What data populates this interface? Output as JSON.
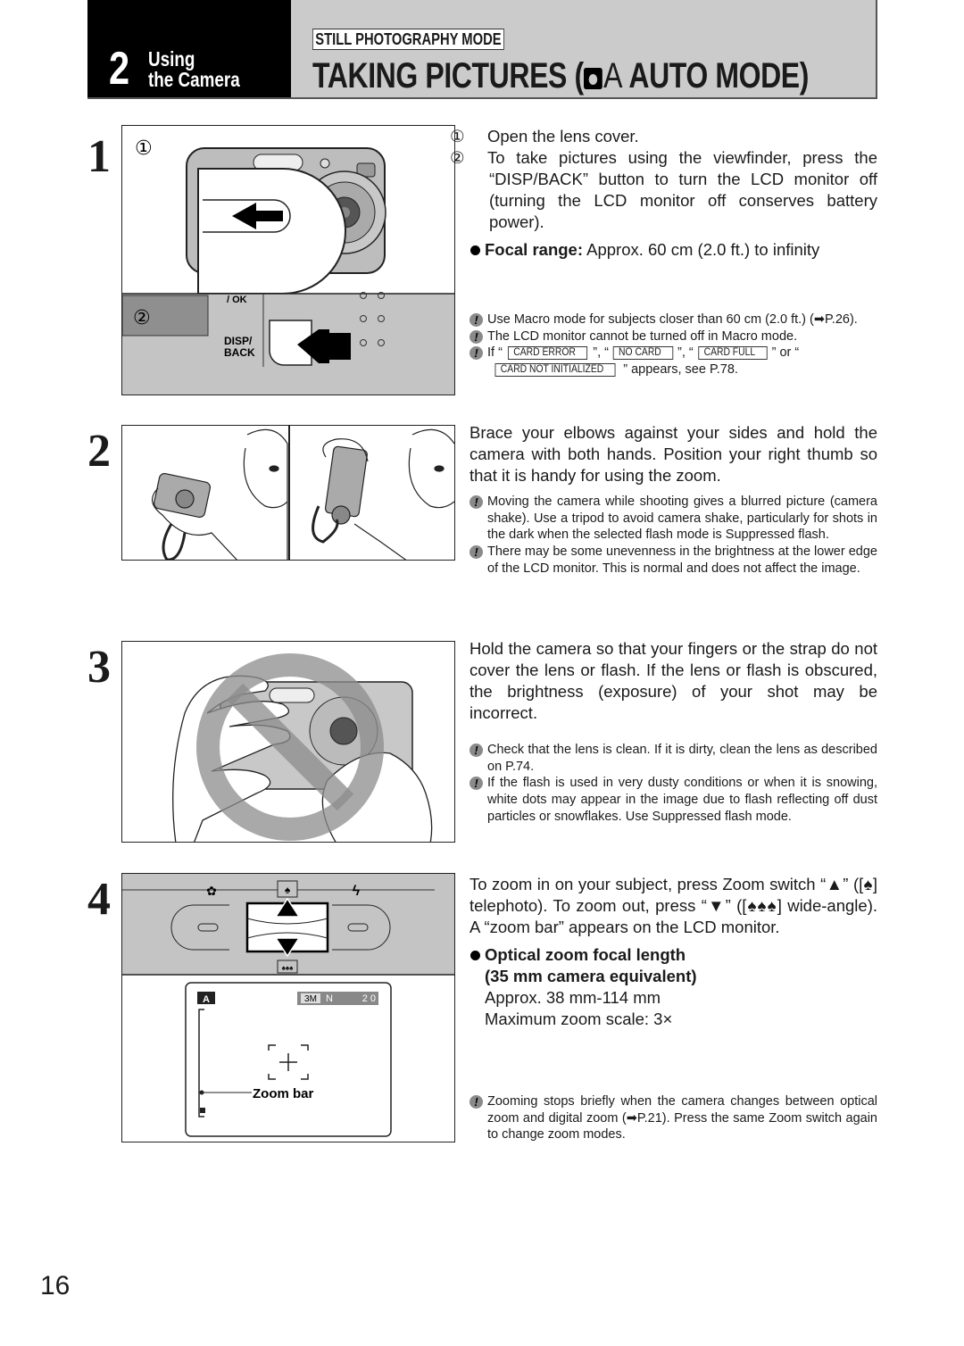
{
  "header": {
    "chapter_number": "2",
    "chapter_title_line1": "Using",
    "chapter_title_line2": "the Camera",
    "mode_label": "STILL PHOTOGRAPHY MODE",
    "title_prefix": "TAKING PICTURES (",
    "title_mode_letter": "A",
    "title_suffix": " AUTO MODE)",
    "colors": {
      "band": "#cbcbcb",
      "chapter_block": "#000000"
    }
  },
  "steps": [
    {
      "number": "1",
      "figure": {
        "sub1": "①",
        "sub2": "②",
        "label_ok": "/ OK",
        "label_disp1": "DISP/",
        "label_disp2": "BACK"
      },
      "items": [
        {
          "marker": "①",
          "text": "Open the lens cover."
        },
        {
          "marker": "②",
          "text": "To take pictures using the viewfinder, press the “DISP/BACK” button to turn the LCD monitor off (turning the LCD monitor off conserves battery power)."
        }
      ],
      "bullet": {
        "label": "Focal range:",
        "text": " Approx. 60 cm (2.0 ft.) to infinity"
      },
      "notes": [
        {
          "text": "Use Macro mode for subjects closer than 60 cm (2.0 ft.) (➡P.26)."
        },
        {
          "text": "The LCD monitor cannot be turned off in Macro mode."
        }
      ],
      "card_note": {
        "prefix": "If “",
        "tag1": "CARD ERROR",
        "sep1": "”, “",
        "tag2": "NO CARD",
        "sep2": "”, “",
        "tag3": "CARD FULL",
        "sep3": "” or “",
        "tag4": "CARD NOT INITIALIZED",
        "suffix": "” appears, see P.78."
      }
    },
    {
      "number": "2",
      "body": "Brace your elbows against your sides and hold the camera with both hands. Position your right thumb so that it is handy for using the zoom.",
      "notes": [
        {
          "text": "Moving the camera while shooting gives a blurred picture (camera shake). Use a tripod to avoid camera shake, particularly for shots in the dark when the selected flash mode is Suppressed flash."
        },
        {
          "text": "There may be some unevenness in the brightness at the lower edge of the LCD monitor. This is normal and does not affect the image."
        }
      ]
    },
    {
      "number": "3",
      "body": "Hold the camera so that your fingers or the strap do not cover the lens or flash. If the lens or flash is obscured, the brightness (exposure) of your shot may be incorrect.",
      "notes": [
        {
          "text": "Check that the lens is clean. If it is dirty, clean the lens as described on P.74."
        },
        {
          "text": "If the flash is used in very dusty conditions or when it is snowing, white dots may appear in the image due to flash reflecting off dust particles or snowflakes. Use Suppressed flash mode."
        }
      ]
    },
    {
      "number": "4",
      "figure": {
        "lcd_mode": "A",
        "lcd_quality_size": "3M",
        "lcd_quality": "N",
        "lcd_shots_remaining": "2 0",
        "zoom_bar_label": "Zoom bar"
      },
      "body": "To zoom in on your subject, press Zoom switch “▲” ([♠] telephoto).  To zoom out, press “▼” ([♠♠♠] wide-angle). A “zoom bar” appears on the LCD monitor.",
      "bullet": {
        "label_line1": "Optical zoom focal length",
        "label_line2": "(35 mm camera equivalent)",
        "line3": "Approx. 38 mm-114 mm",
        "line4": "Maximum zoom scale: 3×"
      },
      "notes": [
        {
          "text": "Zooming stops briefly when the camera changes between optical zoom and digital zoom (➡P.21). Press the same Zoom switch again to change zoom modes."
        }
      ]
    }
  ],
  "page_number": "16",
  "note_icon_symbol": "!"
}
